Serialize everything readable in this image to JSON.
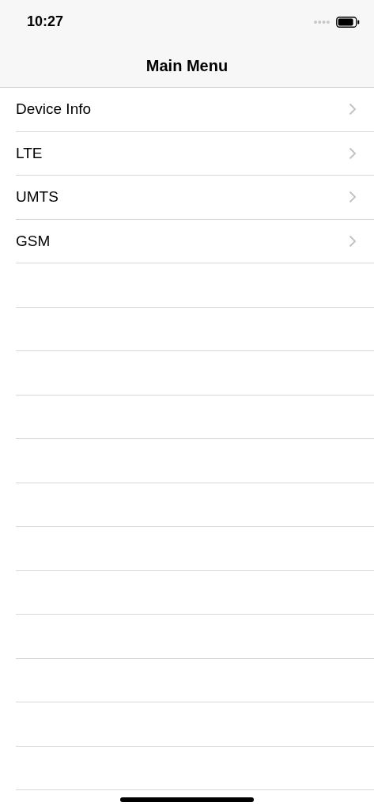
{
  "status_bar": {
    "time": "10:27"
  },
  "nav_bar": {
    "title": "Main Menu"
  },
  "menu": {
    "items": [
      {
        "label": "Device Info"
      },
      {
        "label": "LTE"
      },
      {
        "label": "UMTS"
      },
      {
        "label": "GSM"
      }
    ]
  }
}
